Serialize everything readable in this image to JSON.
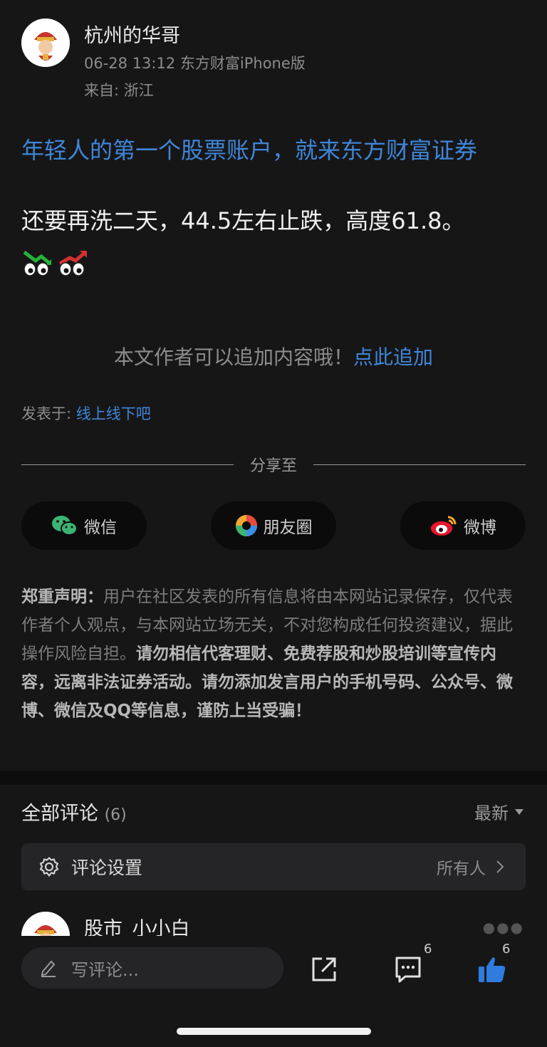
{
  "post": {
    "author": "杭州的华哥",
    "meta": "06-28 13:12 东方财富iPhone版",
    "from": "来自: 浙江",
    "promo": "年轻人的第一个股票账户，就来东方财富证券",
    "body": "还要再洗二天，44.5左右止跌，高度61.8。",
    "append_text": "本文作者可以追加内容哦！",
    "append_link": "点此追加",
    "posted_label": "发表于: ",
    "posted_link": "线上线下吧"
  },
  "share": {
    "label": "分享至",
    "buttons": [
      {
        "label": "微信",
        "icon": "wechat-icon"
      },
      {
        "label": "朋友圈",
        "icon": "moments-icon"
      },
      {
        "label": "微博",
        "icon": "weibo-icon"
      }
    ]
  },
  "disclaimer": {
    "title": "郑重声明：",
    "normal": "用户在社区发表的所有信息将由本网站记录保存，仅代表作者个人观点，与本网站立场无关，不对您构成任何投资建议，据此操作风险自担。",
    "bold": "请勿相信代客理财、免费荐股和炒股培训等宣传内容，远离非法证券活动。请勿添加发言用户的手机号码、公众号、微博、微信及QQ等信息，谨防上当受骗！"
  },
  "comments": {
    "title": "全部评论",
    "count": "(6)",
    "sort": "最新",
    "settings_label": "评论设置",
    "settings_value": "所有人",
    "first_user": "股市_小小白"
  },
  "bottom": {
    "write_placeholder": "写评论...",
    "comment_count": "6",
    "like_count": "6"
  },
  "colors": {
    "background": "#161617",
    "link": "#3f86d8",
    "like": "#2f7be0"
  }
}
